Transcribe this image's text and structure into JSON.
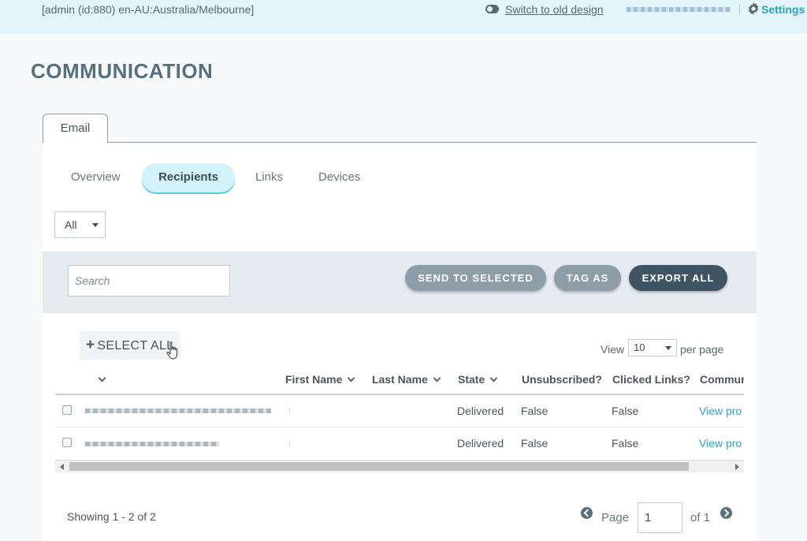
{
  "topbar": {
    "user_info": "[admin (id:880) en-AU:Australia/Melbourne]",
    "switch_label": "Switch to old design",
    "settings_label": "Settings"
  },
  "page": {
    "title": "COMMUNICATION"
  },
  "tabs": {
    "email": "Email"
  },
  "subtabs": [
    {
      "label": "Overview"
    },
    {
      "label": "Recipients",
      "active": true
    },
    {
      "label": "Links"
    },
    {
      "label": "Devices"
    }
  ],
  "filter": {
    "value": "All"
  },
  "toolbar": {
    "search_placeholder": "Search",
    "send_to_selected": "SEND TO SELECTED",
    "tag_as": "TAG AS",
    "export_all": "EXPORT ALL"
  },
  "list": {
    "select_all": "SELECT ALL",
    "view_label": "View",
    "per_page_value": "10",
    "per_page_label": "per page"
  },
  "table": {
    "columns": [
      "",
      "First Name",
      "Last Name",
      "State",
      "Unsubscribed?",
      "Clicked Links?",
      "Commur"
    ],
    "rows": [
      {
        "state": "Delivered",
        "unsubscribed": "False",
        "clicked": "False",
        "link": "View pro"
      },
      {
        "state": "Delivered",
        "unsubscribed": "False",
        "clicked": "False",
        "link": "View pro"
      }
    ]
  },
  "pagination": {
    "showing": "Showing 1 - 2 of 2",
    "page_label": "Page",
    "page_value": "1",
    "of_label": "of 1"
  },
  "colors": {
    "topbar_bg": "#e3f5fa",
    "accent": "#2aa3c7",
    "title": "#56707f",
    "button_grey": "#8e9ea8",
    "button_dark": "#3f5565",
    "active_pill": "#d2f2fa"
  }
}
